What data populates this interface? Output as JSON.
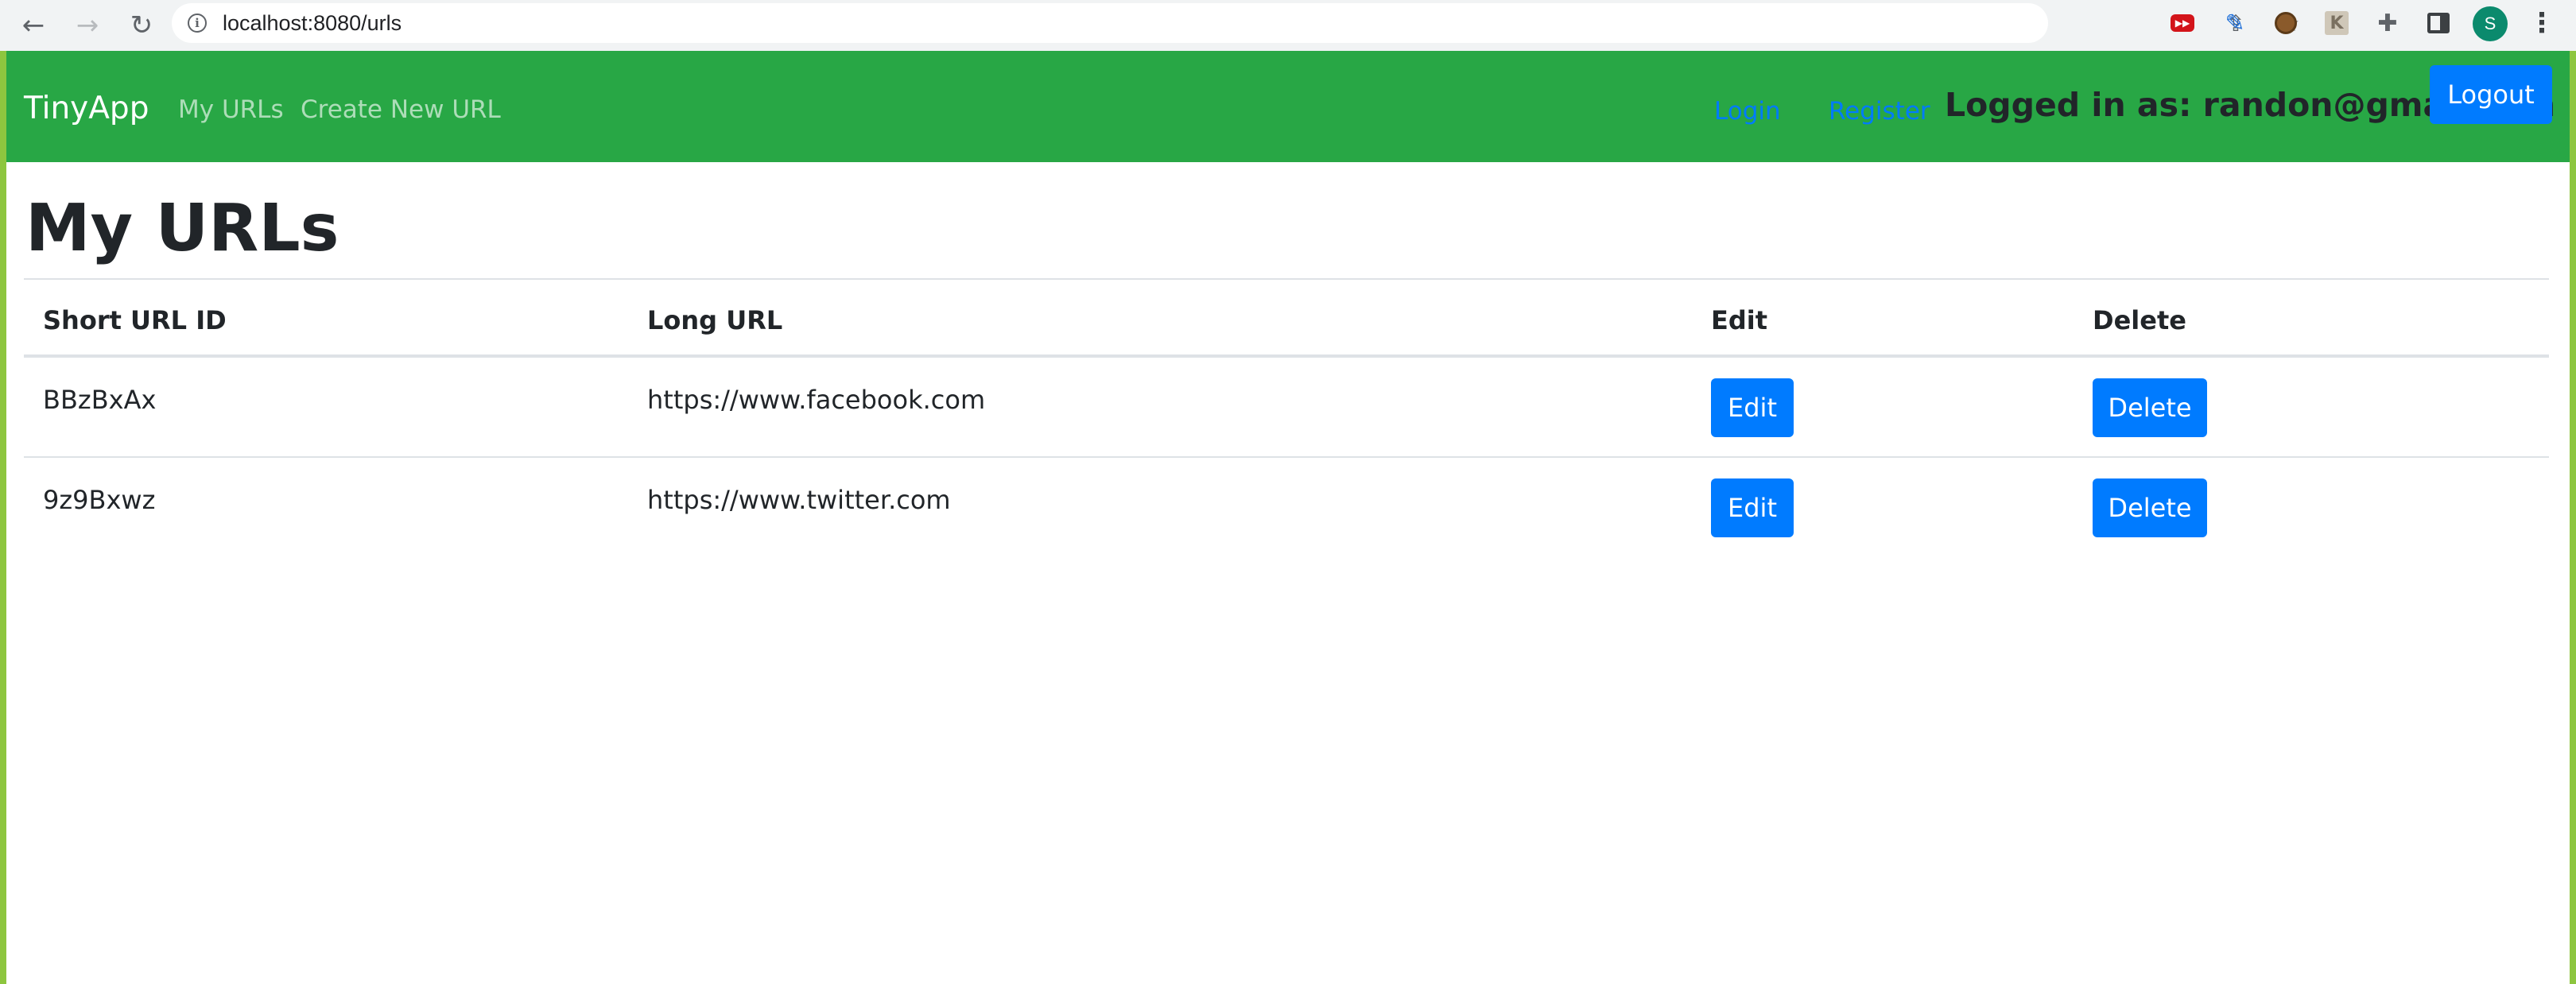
{
  "browser": {
    "url": "localhost:8080/urls",
    "profile_initial": "S"
  },
  "navbar": {
    "brand": "TinyApp",
    "links": [
      "My URLs",
      "Create New URL"
    ],
    "login": "Login",
    "register": "Register",
    "logged_in_text": "Logged in as: randon@gmail.com",
    "logout": "Logout"
  },
  "main": {
    "title": "My URLs",
    "table": {
      "headers": [
        "Short URL ID",
        "Long URL",
        "Edit",
        "Delete"
      ],
      "rows": [
        {
          "short_id": "BBzBxAx",
          "long_url": "https://www.facebook.com",
          "edit": "Edit",
          "delete": "Delete"
        },
        {
          "short_id": "9z9Bxwz",
          "long_url": "https://www.twitter.com",
          "edit": "Edit",
          "delete": "Delete"
        }
      ]
    }
  },
  "colors": {
    "navbar": "#28a745",
    "button": "#007bff",
    "link": "#007bff"
  }
}
